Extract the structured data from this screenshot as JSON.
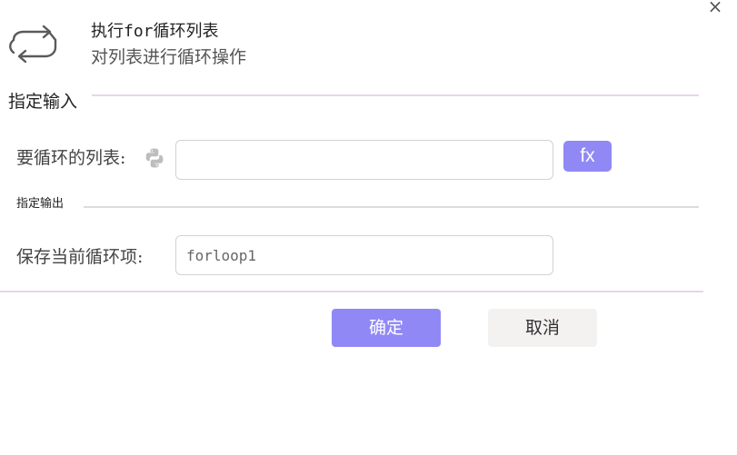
{
  "header": {
    "title": "执行for循环列表",
    "subtitle": "对列表进行循环操作",
    "close_glyph": "×"
  },
  "input_section": {
    "heading": "指定输入",
    "list_label": "要循环的列表:",
    "list_value": "",
    "fx_label": "fx"
  },
  "output_section": {
    "heading": "指定输出",
    "item_label": "保存当前循环项:",
    "item_value": "forloop1"
  },
  "footer": {
    "confirm_label": "确定",
    "cancel_label": "取消"
  },
  "colors": {
    "accent": "#9089f5",
    "divider_accent": "#e9d3ef",
    "divider_plain": "#dcdcdc",
    "cancel_bg": "#f4f1f1",
    "icon_gray": "#5a5a5a"
  },
  "icons": {
    "header": "loop-icon",
    "variable": "python-icon",
    "close": "close-icon"
  }
}
